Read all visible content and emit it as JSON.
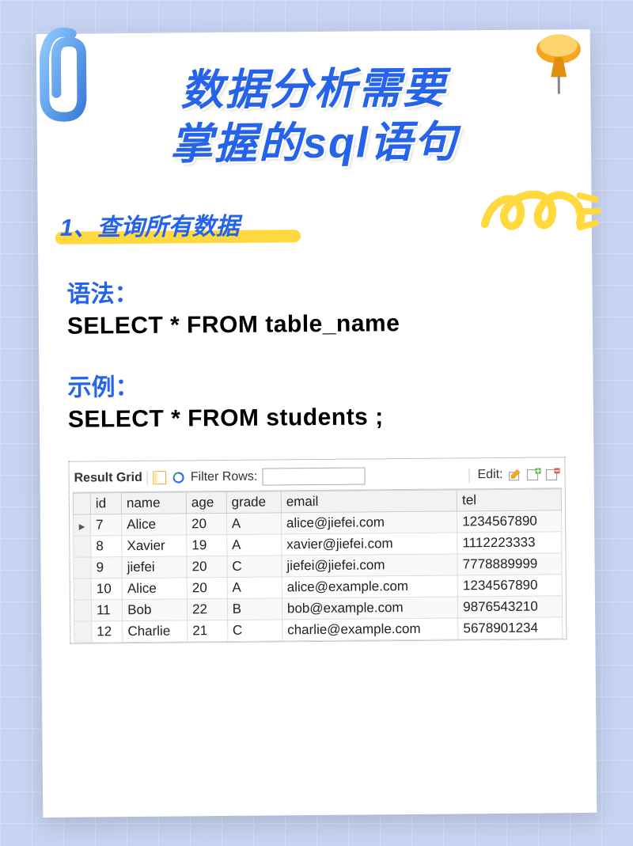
{
  "title_line1": "数据分析需要",
  "title_line2": "掌握的sql语句",
  "section1_label": "1、查询所有数据",
  "syntax_label": "语法：",
  "syntax_code": "SELECT * FROM table_name",
  "example_label": "示例：",
  "example_code": "SELECT * FROM students ;",
  "toolbar": {
    "result_grid": "Result Grid",
    "filter_rows": "Filter Rows:",
    "edit": "Edit:"
  },
  "columns": [
    "id",
    "name",
    "age",
    "grade",
    "email",
    "tel"
  ],
  "rows": [
    {
      "id": "7",
      "name": "Alice",
      "age": "20",
      "grade": "A",
      "email": "alice@jiefei.com",
      "tel": "1234567890"
    },
    {
      "id": "8",
      "name": "Xavier",
      "age": "19",
      "grade": "A",
      "email": "xavier@jiefei.com",
      "tel": "1112223333"
    },
    {
      "id": "9",
      "name": "jiefei",
      "age": "20",
      "grade": "C",
      "email": "jiefei@jiefei.com",
      "tel": "7778889999"
    },
    {
      "id": "10",
      "name": "Alice",
      "age": "20",
      "grade": "A",
      "email": "alice@example.com",
      "tel": "1234567890"
    },
    {
      "id": "11",
      "name": "Bob",
      "age": "22",
      "grade": "B",
      "email": "bob@example.com",
      "tel": "9876543210"
    },
    {
      "id": "12",
      "name": "Charlie",
      "age": "21",
      "grade": "C",
      "email": "charlie@example.com",
      "tel": "5678901234"
    }
  ]
}
